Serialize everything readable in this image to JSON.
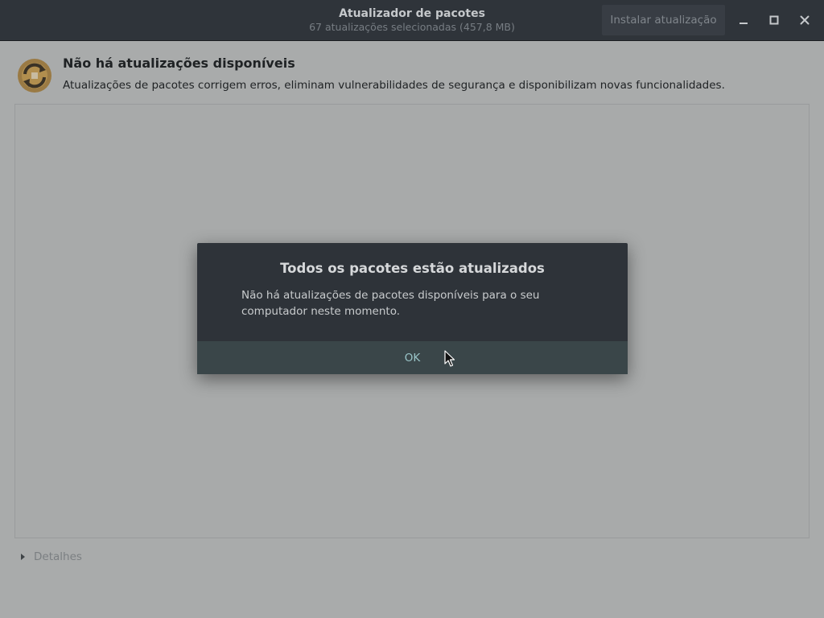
{
  "window": {
    "title": "Atualizador de pacotes",
    "subtitle": "67 atualizações selecionadas (457,8 MB)",
    "install_label": "Instalar atualização",
    "controls": {
      "minimize_icon": "minimize-icon",
      "maximize_icon": "maximize-icon",
      "close_icon": "close-icon"
    }
  },
  "main": {
    "icon": "software-update-icon",
    "heading": "Não há atualizações disponíveis",
    "description": "Atualizações de pacotes corrigem erros, eliminam vulnerabilidades de segurança e disponibilizam novas funcionalidades.",
    "details_label": "Detalhes"
  },
  "dialog": {
    "title": "Todos os pacotes estão atualizados",
    "message": "Não há atualizações de pacotes disponíveis para o seu computador neste momento.",
    "ok_label": "OK"
  },
  "colors": {
    "titlebar": "#2f343a",
    "dimmed_background": "#a9abab",
    "dialog": "#2e3339",
    "dialog_button": "#3a4649",
    "accent_text": "#9ac5c8"
  }
}
